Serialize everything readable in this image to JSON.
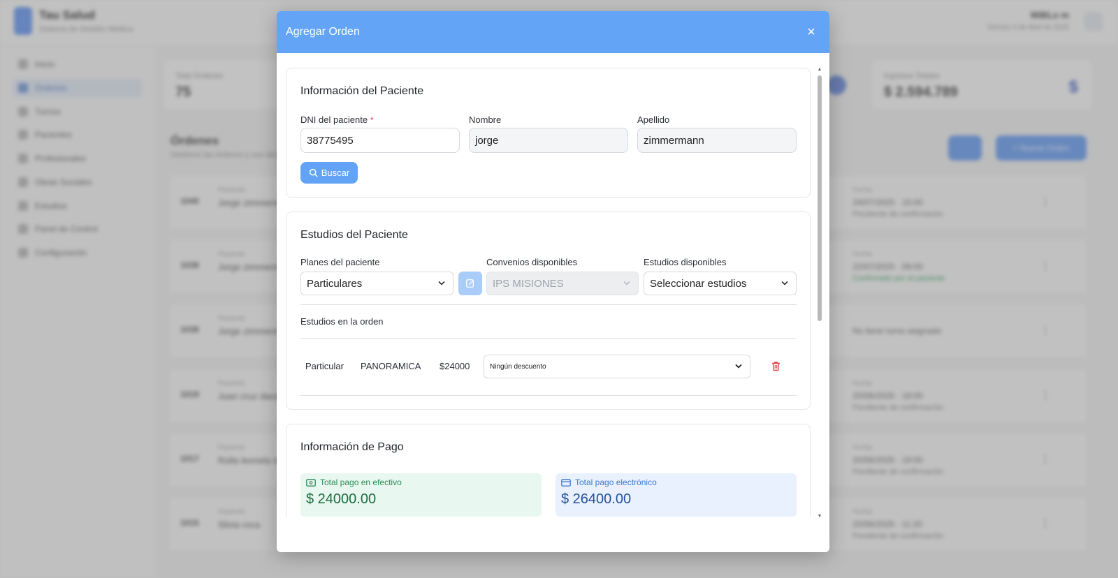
{
  "background": {
    "brand_title": "Tau Salud",
    "brand_subtitle": "Sistema de Gestión Médica",
    "user_name": "MiBLo m",
    "user_date": "Viernes 4 de Abril de 2025",
    "nav": [
      "Inicio",
      "Órdenes",
      "Turnos",
      "Pacientes",
      "Profesionales",
      "Obras Sociales",
      "Estudios",
      "Panel de Control",
      "Configuración"
    ],
    "stat_total_label": "Total Órdenes",
    "stat_total_value": "75",
    "stat_income_label": "Ingresos Totales",
    "stat_income_value": "$ 2.594.789",
    "list_title": "Órdenes",
    "list_subtitle": "Gestione las órdenes y sus detalles",
    "new_order_button": "+ Nueva Orden",
    "rows": [
      {
        "id": "1040",
        "placeholder": "Paciente",
        "name": "Jorge zimmermann",
        "date_label": "Fecha",
        "date": "24/07/2025 · 15:00",
        "status": "Pendiente de confirmación",
        "ok": false
      },
      {
        "id": "1039",
        "placeholder": "Paciente",
        "name": "Jorge zimmermann",
        "date_label": "Fecha",
        "date": "22/07/2025 · 09:00",
        "status": "Confirmado por el paciente",
        "ok": true
      },
      {
        "id": "1038",
        "placeholder": "Paciente",
        "name": "Jorge zimmermann",
        "date_label": "",
        "date": "No tiene turno asignado",
        "status": "",
        "ok": false
      },
      {
        "id": "1019",
        "placeholder": "Paciente",
        "name": "Juan cruz dacal",
        "date_label": "Fecha",
        "date": "20/06/2025 · 18:00",
        "status": "Pendiente de confirmación",
        "ok": false
      },
      {
        "id": "1017",
        "placeholder": "Paciente",
        "name": "Rolla leonela sil",
        "date_label": "Fecha",
        "date": "20/06/2025 · 19:00",
        "status": "Pendiente de confirmación",
        "ok": false
      },
      {
        "id": "1015",
        "placeholder": "Paciente",
        "name": "Silvia roca",
        "date_label": "Fecha",
        "date": "20/06/2025 · 11:20",
        "status": "Pendiente de confirmación",
        "ok": false
      }
    ]
  },
  "modal": {
    "title": "Agregar Orden",
    "close_icon": "×",
    "patient": {
      "title": "Información del Paciente",
      "dni_label": "DNI del paciente",
      "required_mark": "*",
      "dni_value": "38775495",
      "name_label": "Nombre",
      "name_value": "jorge",
      "surname_label": "Apellido",
      "surname_value": "zimmermann",
      "search_button": "Buscar"
    },
    "studies": {
      "title": "Estudios del Paciente",
      "plans_label": "Planes del paciente",
      "plans_value": "Particulares",
      "agreements_label": "Convenios disponibles",
      "agreements_value": "IPS MISIONES",
      "available_label": "Estudios disponibles",
      "available_value": "Seleccionar estudios",
      "in_order_label": "Estudios en la orden",
      "item": {
        "plan": "Particular",
        "study": "PANORAMICA",
        "price": "$24000",
        "discount": "Ningún descuento"
      }
    },
    "payment": {
      "title": "Información de Pago",
      "cash_label": "Total pago en efectivo",
      "cash_amount": "$ 24000.00",
      "electronic_label": "Total pago electrónico",
      "electronic_amount": "$ 26400.00"
    }
  },
  "colors": {
    "header_blue": "#64a4f6",
    "button_blue": "#63a3f5",
    "cash_green": "#2c8d57",
    "electronic_blue": "#3d7ad4",
    "delete_red": "#e0474c"
  },
  "icons": [
    "search-icon",
    "edit-icon",
    "chevron-down-icon",
    "trash-icon",
    "cash-icon",
    "card-icon",
    "close-icon"
  ]
}
